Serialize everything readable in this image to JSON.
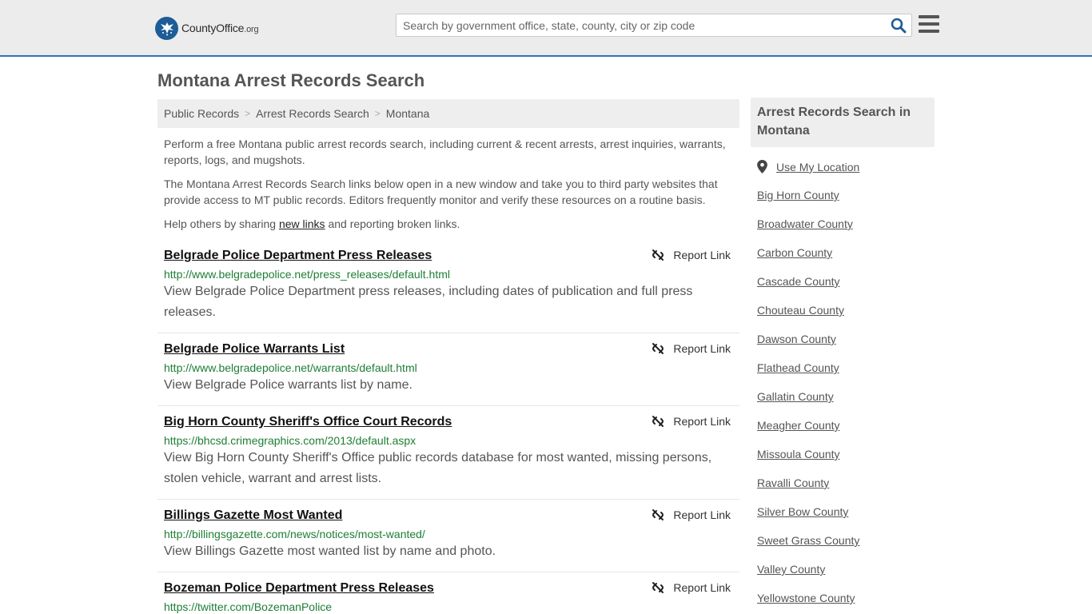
{
  "header": {
    "logo_brand": "CountyOffice",
    "logo_tld": ".org",
    "search_placeholder": "Search by government office, state, county, city or zip code"
  },
  "page_title": "Montana Arrest Records Search",
  "breadcrumb": [
    "Public Records",
    "Arrest Records Search",
    "Montana"
  ],
  "intro": {
    "p1": "Perform a free Montana public arrest records search, including current & recent arrests, arrest inquiries, warrants, reports, logs, and mugshots.",
    "p2": "The Montana Arrest Records Search links below open in a new window and take you to third party websites that provide access to MT public records. Editors frequently monitor and verify these resources on a routine basis.",
    "p3_before": "Help others by sharing ",
    "p3_link": "new links",
    "p3_after": " and reporting broken links."
  },
  "report_label": "Report Link",
  "results": [
    {
      "title": "Belgrade Police Department Press Releases",
      "url": "http://www.belgradepolice.net/press_releases/default.html",
      "desc": "View Belgrade Police Department press releases, including dates of publication and full press releases."
    },
    {
      "title": "Belgrade Police Warrants List",
      "url": "http://www.belgradepolice.net/warrants/default.html",
      "desc": "View Belgrade Police warrants list by name."
    },
    {
      "title": "Big Horn County Sheriff's Office Court Records",
      "url": "https://bhcsd.crimegraphics.com/2013/default.aspx",
      "desc": "View Big Horn County Sheriff's Office public records database for most wanted, missing persons, stolen vehicle, warrant and arrest lists."
    },
    {
      "title": "Billings Gazette Most Wanted",
      "url": "http://billingsgazette.com/news/notices/most-wanted/",
      "desc": "View Billings Gazette most wanted list by name and photo."
    },
    {
      "title": "Bozeman Police Department Press Releases",
      "url": "https://twitter.com/BozemanPolice",
      "desc": ""
    }
  ],
  "sidebar": {
    "title": "Arrest Records Search in Montana",
    "use_location": "Use My Location",
    "counties": [
      "Big Horn County",
      "Broadwater County",
      "Carbon County",
      "Cascade County",
      "Chouteau County",
      "Dawson County",
      "Flathead County",
      "Gallatin County",
      "Meagher County",
      "Missoula County",
      "Ravalli County",
      "Silver Bow County",
      "Sweet Grass County",
      "Valley County",
      "Yellowstone County"
    ]
  },
  "colors": {
    "accent_border": "#2f75b4",
    "logo_blue": "#1d5c96",
    "url_green": "#1e7e34"
  }
}
